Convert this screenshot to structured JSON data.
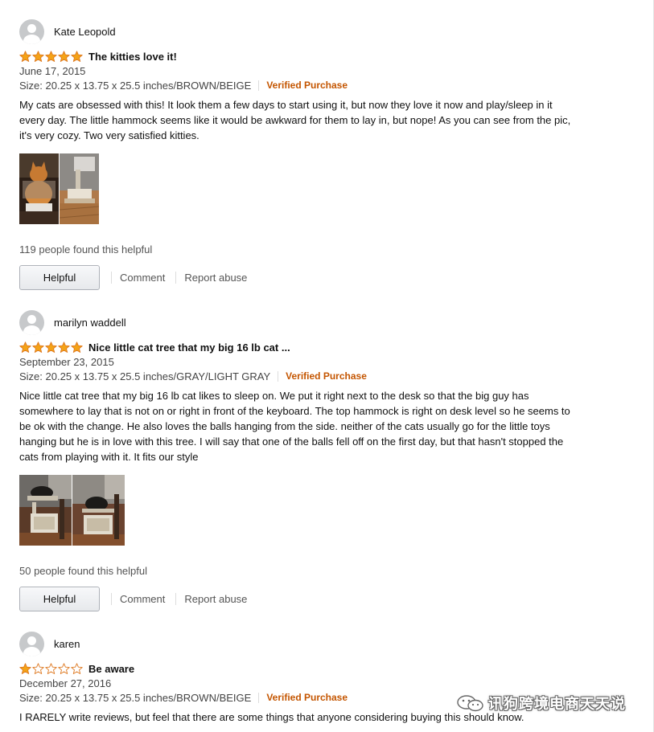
{
  "reviews": [
    {
      "profile_name": "Kate Leopold",
      "rating": 5,
      "title": "The kitties love it!",
      "date": "June 17, 2015",
      "size_label": "Size: 20.25 x 13.75 x 25.5 inches/BROWN/BEIGE",
      "verified_label": "Verified Purchase",
      "body": "My cats are obsessed with this! It look them a few days to start using it, but now they love it now and play/sleep in it every day. The little hammock seems like it would be awkward for them to lay in, but nope! As you can see from the pic, it's very cozy. Two very satisfied kitties.",
      "helpful_count": "119 people found this helpful",
      "helpful_button": "Helpful",
      "comment_link": "Comment",
      "report_link": "Report abuse"
    },
    {
      "profile_name": "marilyn waddell",
      "rating": 5,
      "title": "Nice little cat tree that my big 16 lb cat ...",
      "date": "September 23, 2015",
      "size_label": "Size: 20.25 x 13.75 x 25.5 inches/GRAY/LIGHT GRAY",
      "verified_label": "Verified Purchase",
      "body": "Nice little cat tree that my big 16 lb cat likes to sleep on. We put it right next to the desk so that the big guy has somewhere to lay that is not on or right in front of the keyboard. The top hammock is right on desk level so he seems to be ok with the change. He also loves the balls hanging from the side. neither of the cats usually go for the little toys hanging but he is in love with this tree. I will say that one of the balls fell off on the first day, but that hasn't stopped the cats from playing with it. It fits our style",
      "helpful_count": "50 people found this helpful",
      "helpful_button": "Helpful",
      "comment_link": "Comment",
      "report_link": "Report abuse"
    },
    {
      "profile_name": "karen",
      "rating": 1,
      "title": "Be aware",
      "date": "December 27, 2016",
      "size_label": "Size: 20.25 x 13.75 x 25.5 inches/BROWN/BEIGE",
      "verified_label": "Verified Purchase",
      "body": "I RARELY write reviews, but feel that there are some things that anyone considering buying this should know."
    }
  ],
  "watermark": {
    "text": "讯狗跨境电商天天说",
    "icon": "wechat-icon"
  },
  "colors": {
    "star": "#f4a317",
    "star_outline": "#de7921",
    "verified": "#c45500"
  }
}
